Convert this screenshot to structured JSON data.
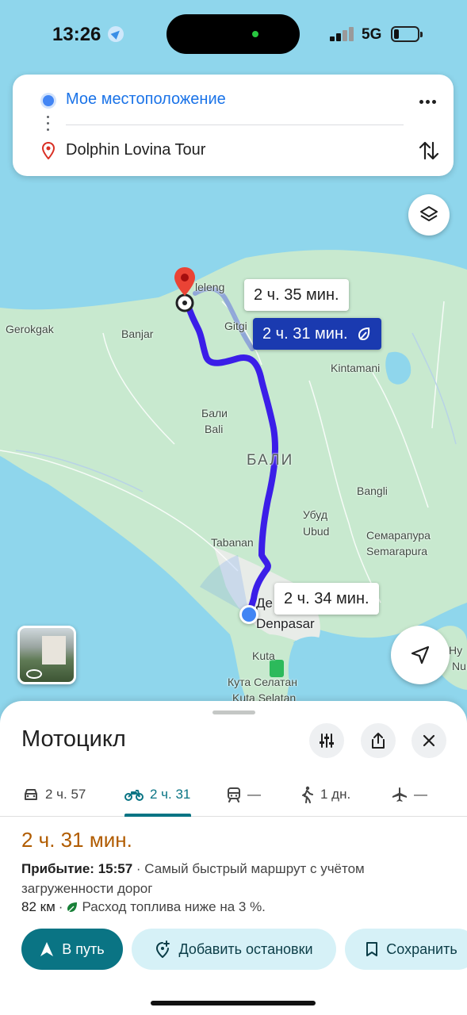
{
  "status_bar": {
    "time": "13:26",
    "network": "5G"
  },
  "route_card": {
    "origin": "Мое местоположение",
    "destination": "Dolphin Lovina Tour"
  },
  "map": {
    "labels": {
      "gerokgak": "Gerokgak",
      "banjar": "Banjar",
      "leleng": "leleng",
      "gitgit": "Gitgi",
      "kintamani": "Kintamani",
      "bali_ru": "Бали",
      "bali_en": "Bali",
      "bali_caps": "БАЛИ",
      "bangli": "Bangli",
      "ubud_ru": "Убуд",
      "ubud_en": "Ubud",
      "semarapura_ru": "Семарапура",
      "semarapura_en": "Semarapura",
      "tabanan": "Tabanan",
      "denpasar_partial": "Де",
      "denpasar": "Denpasar",
      "kuta": "Kuta",
      "kuta_selatan_ru": "Кута Селатан",
      "kuta_selatan_en": "Kuta Selatan",
      "nusa_partial_1": "Ну",
      "nusa_partial_2": "Nu"
    },
    "route_times": {
      "alt1": "2 ч. 35 мин.",
      "main": "2 ч. 31 мин.",
      "alt2": "2 ч. 34 мин."
    },
    "colors": {
      "route": "#3b1ee8",
      "water": "#8fd6ec",
      "land": "#c8e9cf"
    }
  },
  "sheet": {
    "title": "Мотоцикл",
    "modes": [
      {
        "name": "car",
        "label": "2 ч. 57"
      },
      {
        "name": "motorcycle",
        "label": "2 ч. 31"
      },
      {
        "name": "transit",
        "label": "—"
      },
      {
        "name": "walk",
        "label": "1 дн."
      },
      {
        "name": "flight",
        "label": "—"
      }
    ],
    "eta": "2 ч. 31 мин.",
    "arrival_label": "Прибытие: 15:57",
    "arrival_note": " · Самый быстрый маршрут с учётом загруженности дорог",
    "distance": "82 км",
    "fuel_note": "Расход топлива ниже на 3 %.",
    "actions": {
      "go": "В путь",
      "add_stops": "Добавить остановки",
      "save": "Сохранить"
    }
  }
}
